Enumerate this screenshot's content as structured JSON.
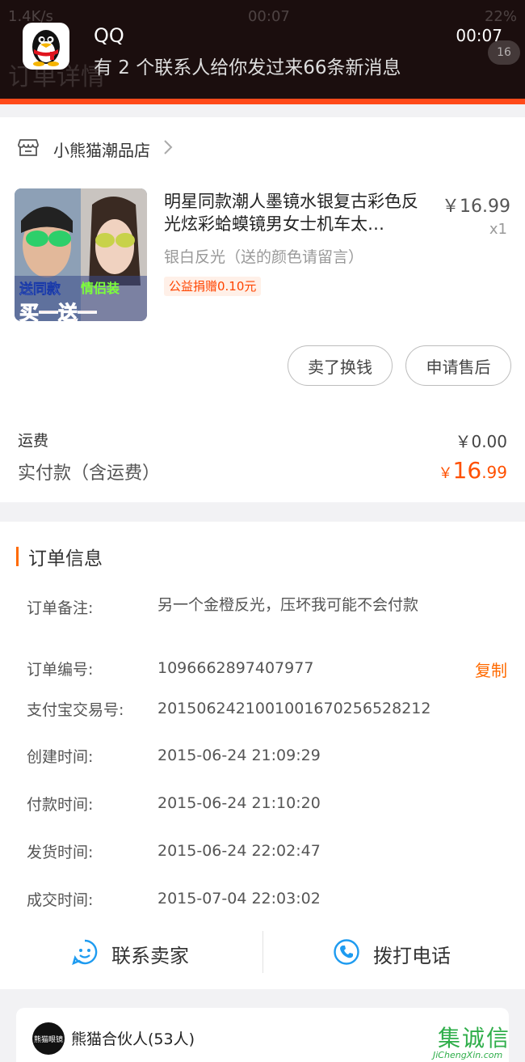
{
  "notification": {
    "app_name": "QQ",
    "message": "有 2 个联系人给你发过来66条新消息",
    "time": "00:07",
    "underlay_status": "1.4K/s",
    "underlay_clock": "00:07",
    "underlay_battery": "22%",
    "underlay_title": "订单详情",
    "underlay_badge": "16"
  },
  "store": {
    "name": "小熊猫潮品店"
  },
  "product": {
    "title": "明星同款潮人墨镜水银复古彩色反光炫彩蛤蟆镜男女士机车太…",
    "price": "￥16.99",
    "quantity": "x1",
    "sku": "银白反光（送的颜色请留言）",
    "donation": "公益捐赠0.10元",
    "image_caption_1": "送同款",
    "image_caption_2": "情侣装",
    "image_caption_3": "买一送一"
  },
  "buttons": {
    "sell": "卖了换钱",
    "after_sales": "申请售后"
  },
  "totals": {
    "shipping_label": "运费",
    "shipping_value": "￥0.00",
    "paid_label": "实付款（含运费）",
    "paid_currency": "￥",
    "paid_int": "16",
    "paid_dec": ".99"
  },
  "order_info": {
    "title": "订单信息",
    "rows": [
      {
        "label": "订单备注:",
        "value": "另一个金橙反光，压坏我可能不会付款"
      },
      {
        "label": "订单编号:",
        "value": "1096662897407977"
      },
      {
        "label": "支付宝交易号:",
        "value": "2015062421001001670256528212"
      },
      {
        "label": "创建时间:",
        "value": "2015-06-24 21:09:29"
      },
      {
        "label": "付款时间:",
        "value": "2015-06-24 21:10:20"
      },
      {
        "label": "发货时间:",
        "value": "2015-06-24 22:02:47"
      },
      {
        "label": "成交时间:",
        "value": "2015-07-04 22:03:02"
      }
    ],
    "copy_label": "复制",
    "contact_seller": "联系卖家",
    "call_phone": "拨打电话"
  },
  "partner": {
    "text": "熊猫合伙人(53人)",
    "logo_text": "熊猫眼镜"
  },
  "watermark": {
    "cn": "集诚信",
    "en": "JiChengXin.com"
  },
  "colors": {
    "accent": "#ff6a00",
    "price": "#ff5000",
    "link_blue": "#1e9bf0"
  }
}
